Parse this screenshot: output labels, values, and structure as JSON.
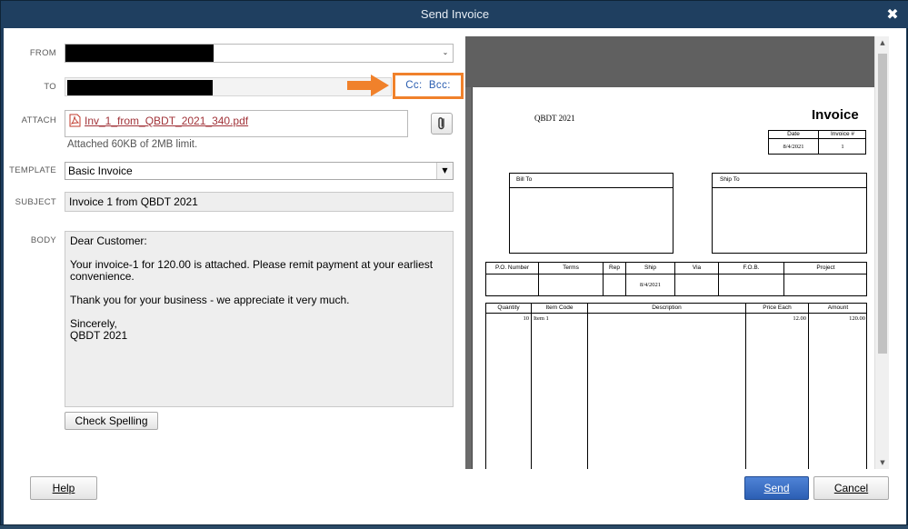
{
  "window": {
    "title": "Send Invoice",
    "close_glyph": "✖"
  },
  "labels": {
    "from": "FROM",
    "to": "TO",
    "attach": "ATTACH",
    "template": "TEMPLATE",
    "subject": "SUBJECT",
    "body": "BODY"
  },
  "cc_bcc": {
    "cc": "Cc:",
    "bcc": "Bcc:"
  },
  "attachment": {
    "file_name": "Inv_1_from_QBDT_2021_340.pdf",
    "limit_text": "Attached 60KB of 2MB limit."
  },
  "template": {
    "selected": "Basic Invoice"
  },
  "subject": {
    "value": "Invoice 1 from QBDT 2021"
  },
  "body": {
    "greeting": "Dear Customer:",
    "line1": "Your invoice-1 for 120.00 is attached. Please remit payment at your earliest convenience.",
    "line2": "Thank you for your business - we appreciate it very much.",
    "closing": "Sincerely,",
    "signature": "QBDT 2021"
  },
  "buttons": {
    "check_spelling": "Check Spelling",
    "help": "Help",
    "send": "Send",
    "cancel": "Cancel"
  },
  "invoice_preview": {
    "company": "QBDT 2021",
    "title": "Invoice",
    "date_header": "Date",
    "invoice_no_header": "Invoice #",
    "date": "8/4/2021",
    "invoice_no": "1",
    "bill_to": "Bill To",
    "ship_to": "Ship To",
    "po_headers": [
      "P.O. Number",
      "Terms",
      "Rep",
      "Ship",
      "Via",
      "F.O.B.",
      "Project"
    ],
    "ship_date": "8/4/2021",
    "item_headers": [
      "Quantity",
      "Item Code",
      "Description",
      "Price Each",
      "Amount"
    ],
    "item_row": {
      "quantity": "10",
      "item_code": "Item 1",
      "price_each": "12.00",
      "amount": "120.00"
    }
  },
  "colors": {
    "accent_orange": "#f0812b",
    "send_blue": "#2c5fb4",
    "link_red": "#a2343a"
  },
  "icons": [
    "close-icon",
    "dropdown-arrow-icon",
    "pdf-icon",
    "paperclip-icon",
    "arrow-right-icon"
  ]
}
